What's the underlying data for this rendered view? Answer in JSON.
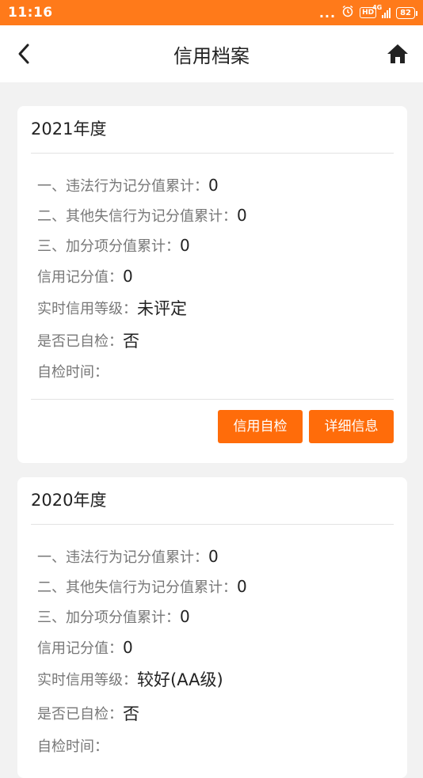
{
  "status_bar": {
    "time": "11:16",
    "dots": "...",
    "hd": "HD",
    "network": "4G",
    "battery": "82"
  },
  "nav": {
    "title": "信用档案"
  },
  "cards": [
    {
      "year": "2021年度",
      "rows": [
        {
          "label": "一、违法行为记分值累计：",
          "value": "0"
        },
        {
          "label": "二、其他失信行为记分值累计：",
          "value": "0"
        },
        {
          "label": "三、加分项分值累计：",
          "value": "0"
        },
        {
          "label": "信用记分值：",
          "value": "0"
        },
        {
          "label": "实时信用等级：",
          "value": "未评定"
        },
        {
          "label": "是否已自检：",
          "value": "否"
        },
        {
          "label": "自检时间：",
          "value": ""
        }
      ],
      "buttons": {
        "self_check": "信用自检",
        "details": "详细信息"
      }
    },
    {
      "year": "2020年度",
      "rows": [
        {
          "label": "一、违法行为记分值累计：",
          "value": "0"
        },
        {
          "label": "二、其他失信行为记分值累计：",
          "value": "0"
        },
        {
          "label": "三、加分项分值累计：",
          "value": "0"
        },
        {
          "label": "信用记分值：",
          "value": "0"
        },
        {
          "label": "实时信用等级：",
          "value": "较好(AA级)"
        },
        {
          "label": "是否已自检：",
          "value": "否"
        },
        {
          "label": "自检时间：",
          "value": ""
        }
      ]
    }
  ],
  "colors": {
    "accent": "#ff7a1a",
    "button": "#ff6c0a",
    "background": "#f2f2f2"
  }
}
